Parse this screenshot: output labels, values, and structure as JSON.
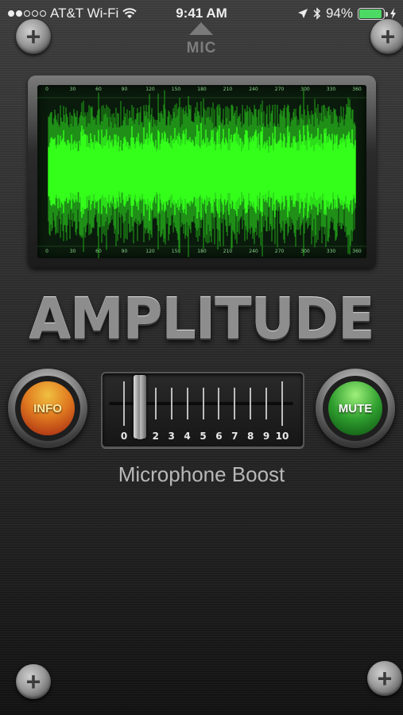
{
  "status_bar": {
    "carrier": "AT&T Wi-Fi",
    "time": "9:41 AM",
    "battery_percent": "94%",
    "battery_level": 0.94,
    "signal_bars": 2
  },
  "mic": {
    "label": "MIC"
  },
  "waveform": {
    "tick_labels": [
      "0",
      "30",
      "60",
      "90",
      "120",
      "150",
      "180",
      "210",
      "240",
      "270",
      "300",
      "330",
      "360"
    ],
    "wave_color": "#33ff1a"
  },
  "logo": {
    "text": "AMPLITUDE"
  },
  "info_button": {
    "label": "INFO"
  },
  "mute_button": {
    "label": "MUTE"
  },
  "boost_slider": {
    "labels": [
      "0",
      "1",
      "2",
      "3",
      "4",
      "5",
      "6",
      "7",
      "8",
      "9",
      "10"
    ],
    "value": 1
  },
  "boost_label": "Microphone Boost",
  "colors": {
    "accent_green": "#33ff1a",
    "info_orange": "#e07a20",
    "mute_green": "#2e9e2e"
  }
}
